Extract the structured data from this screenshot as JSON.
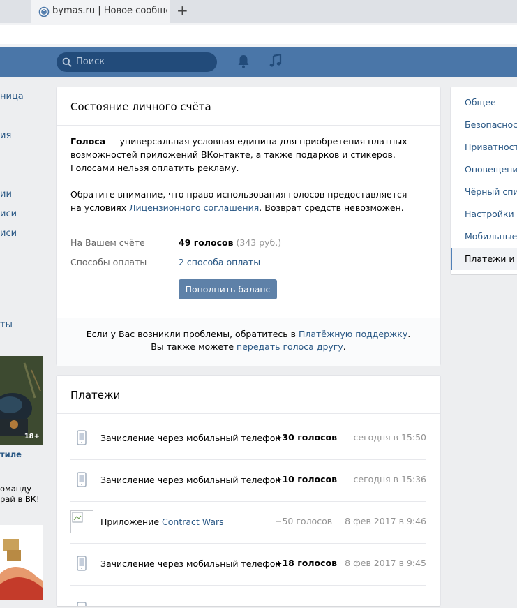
{
  "browser": {
    "tab_title": "bymas.ru | Новое сообщени",
    "new_tab_label": "+"
  },
  "header": {
    "search_placeholder": "Поиск",
    "icons": [
      "search-icon",
      "bell-icon",
      "music-icon"
    ],
    "brand_color": "#4a76a8"
  },
  "left_nav": {
    "items": [
      "ница",
      "ия",
      "ии",
      "иси",
      "иси",
      "ты"
    ],
    "ad": {
      "badge": "18+",
      "title": "тиле",
      "lines": [
        "оманду",
        "рай в ВК!"
      ]
    }
  },
  "balance_card": {
    "title": "Состояние личного счёта",
    "intro": {
      "bold": "Голоса",
      "text": " — универсальная условная единица для приобретения платных возможностей приложений ВКонтакте, а также подарков и стикеров. Голосами нельзя оплатить рекламу."
    },
    "notice": {
      "before": "Обратите внимание, что право использования голосов предоставляется на условиях ",
      "link": "Лицензионного соглашения",
      "after": ". Возврат средств невозможен."
    },
    "balance_label": "На Вашем счёте",
    "balance_value": "49 голосов",
    "balance_rub": "(343 руб.)",
    "methods_label": "Способы оплаты",
    "methods_value": "2 способа оплаты",
    "topup_button": "Пополнить баланс",
    "footer": {
      "line1_before": "Если у Вас возникли проблемы, обратитесь в ",
      "line1_link": "Платёжную поддержку",
      "line1_after": ".",
      "line2_before": "Вы также можете ",
      "line2_link": "передать голоса другу",
      "line2_after": "."
    }
  },
  "payments_card": {
    "title": "Платежи",
    "rows": [
      {
        "icon": "phone-icon",
        "desc": "Зачисление через мобильный телефон",
        "amount": "+30 голосов",
        "date": "сегодня в 15:50"
      },
      {
        "icon": "phone-icon",
        "desc": "Зачисление через мобильный телефон",
        "amount": "+10 голосов",
        "date": "сегодня в 15:36"
      },
      {
        "icon": "app-icon",
        "desc_prefix": "Приложение ",
        "desc_link": "Contract Wars",
        "amount": "−50 голосов",
        "date": "8 фев 2017 в 9:46"
      },
      {
        "icon": "phone-icon",
        "desc": "Зачисление через мобильный телефон",
        "amount": "+18 голосов",
        "date": "8 фев 2017 в 9:45"
      }
    ]
  },
  "settings_menu": {
    "items": [
      "Общее",
      "Безопасность",
      "Приватность",
      "Оповещения",
      "Чёрный список",
      "Настройки приложений",
      "Мобильные сервисы",
      "Платежи и переводы"
    ],
    "active_index": 7
  }
}
